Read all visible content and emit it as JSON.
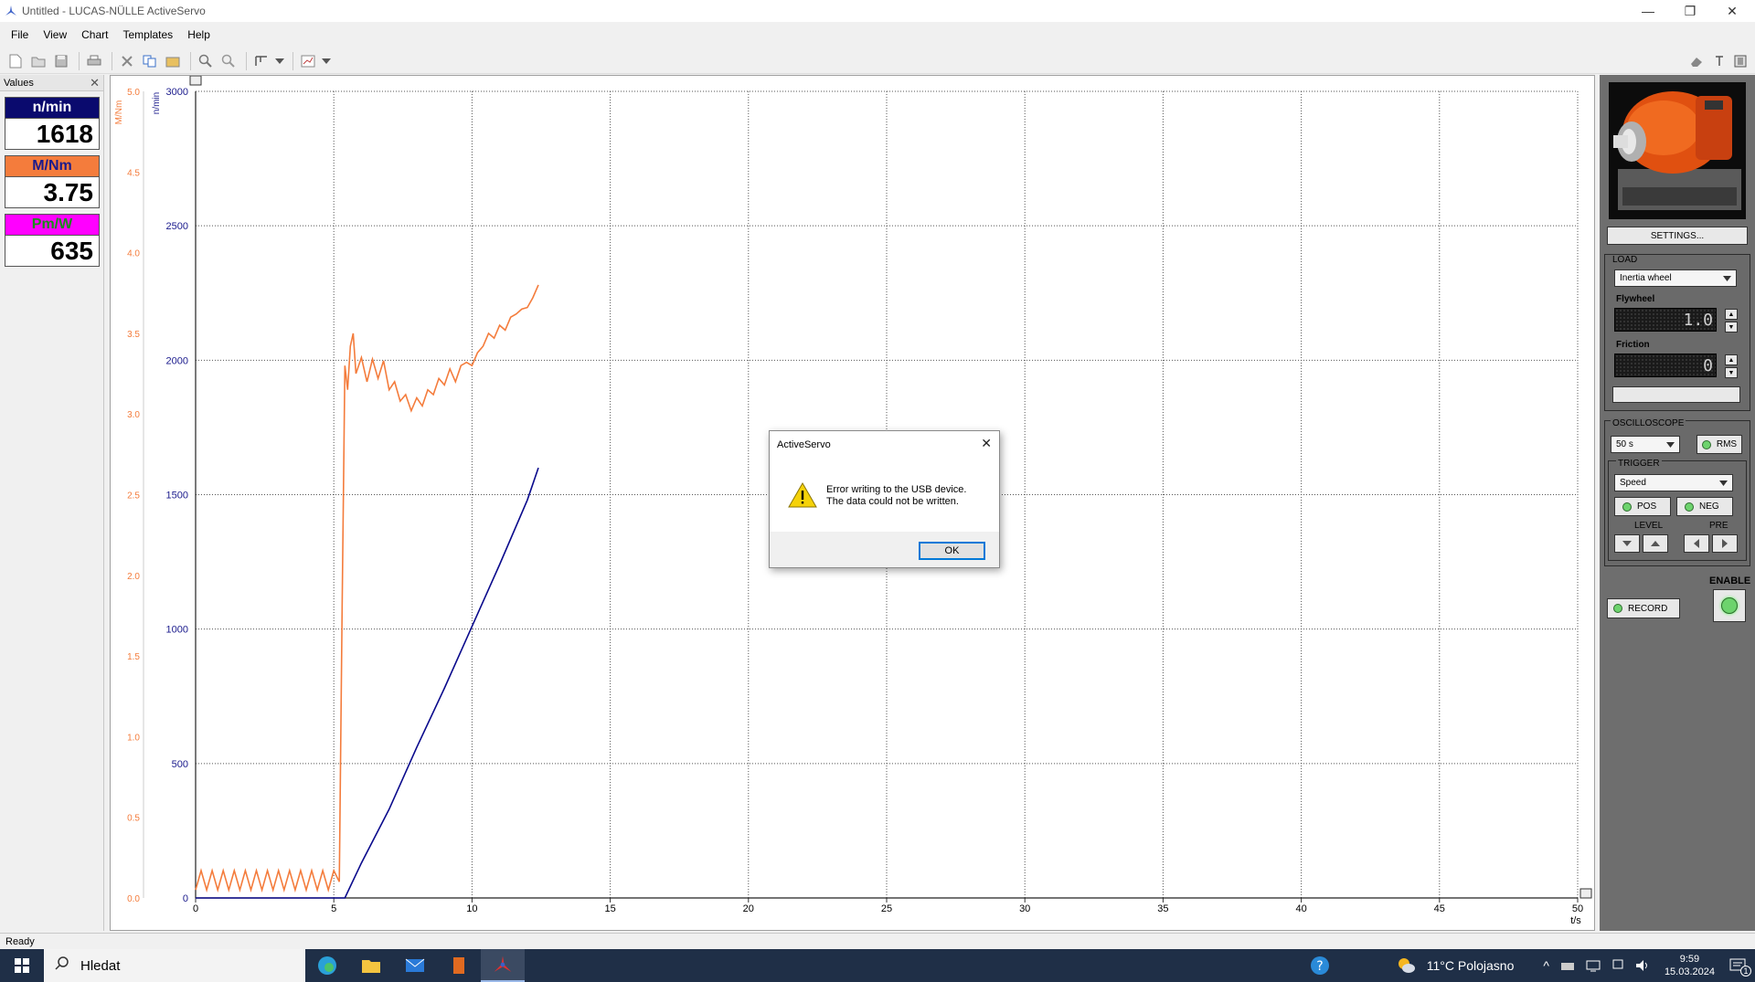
{
  "window": {
    "title": "Untitled - LUCAS-NÜLLE ActiveServo"
  },
  "menu": [
    "File",
    "View",
    "Chart",
    "Templates",
    "Help"
  ],
  "values_panel": {
    "title": "Values",
    "items": [
      {
        "label": "n/min",
        "value": "1618",
        "bg": "#0a0a6e",
        "fg": "#ffffff"
      },
      {
        "label": "M/Nm",
        "value": "3.75",
        "bg": "#f47c3c",
        "fg": "#1a1a8c"
      },
      {
        "label": "Pm/W",
        "value": "635",
        "bg": "#ff00ff",
        "fg": "#1a8c1a"
      }
    ]
  },
  "chart_data": {
    "type": "line",
    "x_axis": {
      "label": "t/s",
      "min": 0,
      "max": 50,
      "ticks": [
        0,
        5,
        10,
        15,
        20,
        25,
        30,
        35,
        40,
        45,
        50
      ]
    },
    "y_axes": [
      {
        "label": "M/Nm",
        "min": 0,
        "max": 5,
        "ticks": [
          "0.0",
          "0.5",
          "1.0",
          "1.5",
          "2.0",
          "2.5",
          "3.0",
          "3.5",
          "4.0",
          "4.5",
          "5.0"
        ],
        "color": "#f47c3c"
      },
      {
        "label": "n/min",
        "min": 0,
        "max": 3000,
        "ticks": [
          0,
          500,
          1000,
          1500,
          2000,
          2500,
          3000
        ],
        "color": "#1a1a8c"
      }
    ],
    "grid": true,
    "series": [
      {
        "axis": "n/min",
        "color": "#0a0a8c",
        "x": [
          0,
          5.2,
          5.4,
          6,
          7,
          8,
          9,
          10,
          11,
          12,
          12.4
        ],
        "y": [
          0,
          0,
          0,
          130,
          330,
          560,
          780,
          1010,
          1240,
          1480,
          1600
        ]
      },
      {
        "axis": "M/Nm",
        "color": "#f47c3c",
        "x": [
          0,
          0.2,
          0.4,
          0.6,
          0.8,
          1.0,
          1.2,
          1.4,
          1.6,
          1.8,
          2.0,
          2.2,
          2.4,
          2.6,
          2.8,
          3.0,
          3.2,
          3.4,
          3.6,
          3.8,
          4.0,
          4.2,
          4.4,
          4.6,
          4.8,
          5.0,
          5.2,
          5.3,
          5.4,
          5.5,
          5.6,
          5.7,
          5.8,
          6.0,
          6.2,
          6.4,
          6.6,
          6.8,
          7.0,
          7.2,
          7.4,
          7.6,
          7.8,
          8.0,
          8.2,
          8.4,
          8.6,
          8.8,
          9.0,
          9.2,
          9.4,
          9.6,
          9.8,
          10.0,
          10.2,
          10.4,
          10.6,
          10.8,
          11.0,
          11.2,
          11.4,
          11.6,
          11.8,
          12.0,
          12.2,
          12.4
        ],
        "y": [
          0.05,
          0.17,
          0.05,
          0.17,
          0.05,
          0.17,
          0.05,
          0.17,
          0.05,
          0.17,
          0.05,
          0.17,
          0.05,
          0.17,
          0.05,
          0.17,
          0.05,
          0.17,
          0.05,
          0.17,
          0.05,
          0.17,
          0.05,
          0.17,
          0.05,
          0.17,
          0.1,
          1.8,
          3.3,
          3.15,
          3.42,
          3.5,
          3.25,
          3.35,
          3.2,
          3.34,
          3.22,
          3.33,
          3.15,
          3.2,
          3.08,
          3.12,
          3.02,
          3.1,
          3.05,
          3.15,
          3.12,
          3.22,
          3.18,
          3.28,
          3.2,
          3.3,
          3.32,
          3.3,
          3.38,
          3.42,
          3.5,
          3.47,
          3.55,
          3.52,
          3.6,
          3.62,
          3.65,
          3.66,
          3.72,
          3.8
        ]
      }
    ]
  },
  "right_panel": {
    "settings_label": "SETTINGS...",
    "load": {
      "title": "LOAD",
      "selected": "Inertia wheel",
      "flywheel_label": "Flywheel",
      "flywheel_value": "1.0",
      "friction_label": "Friction",
      "friction_value": "0"
    },
    "oscilloscope": {
      "title": "OSCILLOSCOPE",
      "timebase": "50 s",
      "rms_label": "RMS",
      "trigger_title": "TRIGGER",
      "trigger_source": "Speed",
      "pos_label": "POS",
      "neg_label": "NEG",
      "level_label": "LEVEL",
      "pre_label": "PRE"
    },
    "enable_label": "ENABLE",
    "record_label": "RECORD"
  },
  "status": {
    "text": "Ready"
  },
  "dialog": {
    "title": "ActiveServo",
    "line1": "Error writing to the USB device.",
    "line2": "The data could not be written.",
    "ok_label": "OK"
  },
  "taskbar": {
    "search_placeholder": "Hledat",
    "weather": "11°C  Polojasno",
    "time": "9:59",
    "date": "15.03.2024",
    "notification_count": "1"
  }
}
